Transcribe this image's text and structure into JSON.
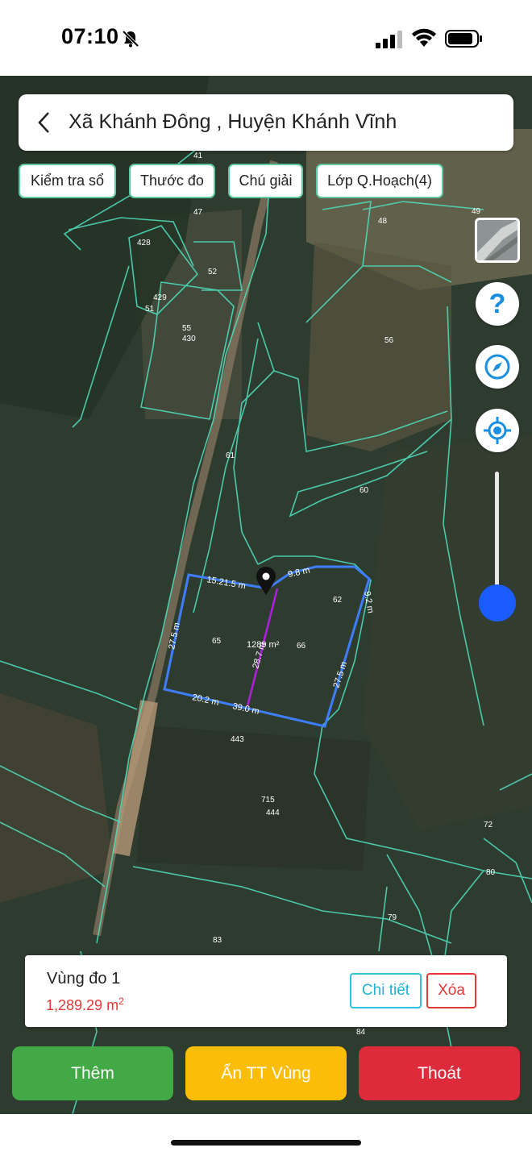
{
  "status_bar": {
    "time": "07:10"
  },
  "header": {
    "title": "Xã Khánh Đông , Huyện Khánh Vĩnh"
  },
  "chips": [
    {
      "label": "Kiểm tra sổ"
    },
    {
      "label": "Thước đo"
    },
    {
      "label": "Chú giải"
    },
    {
      "label": "Lớp Q.Hoạch(4)"
    }
  ],
  "map": {
    "parcel_labels": [
      "41",
      "47",
      "428",
      "52",
      "429",
      "51",
      "55",
      "430",
      "48",
      "49",
      "56",
      "61",
      "60",
      "62",
      "65",
      "66",
      "443",
      "715",
      "444",
      "72",
      "80",
      "79",
      "83",
      "84"
    ],
    "measurements": {
      "top_edge": "15.21.5 m",
      "top_right_edge": "9.8 m",
      "right_short_edge": "9.2 m",
      "left_edge": "27.5 m",
      "area": "1289 m²",
      "divider": "28.7 m",
      "right_edge": "27.5 m",
      "bottom_left": "20.2 m",
      "bottom_right": "39.0 m"
    }
  },
  "controls": {
    "help_symbol": "?",
    "zoom_level": 0.08
  },
  "area_card": {
    "name": "Vùng đo 1",
    "value": "1,289.29 m",
    "unit_sup": "2",
    "detail_label": "Chi tiết",
    "delete_label": "Xóa"
  },
  "actions": {
    "add_label": "Thêm",
    "hide_label": "Ẩn TT Vùng",
    "exit_label": "Thoát"
  },
  "colors": {
    "green": "#43a947",
    "yellow": "#fbbd08",
    "red": "#de2b3c",
    "boundary": "#3f7dff",
    "divider": "#b01fe0",
    "parcel_lines": "#4fd8b8"
  }
}
